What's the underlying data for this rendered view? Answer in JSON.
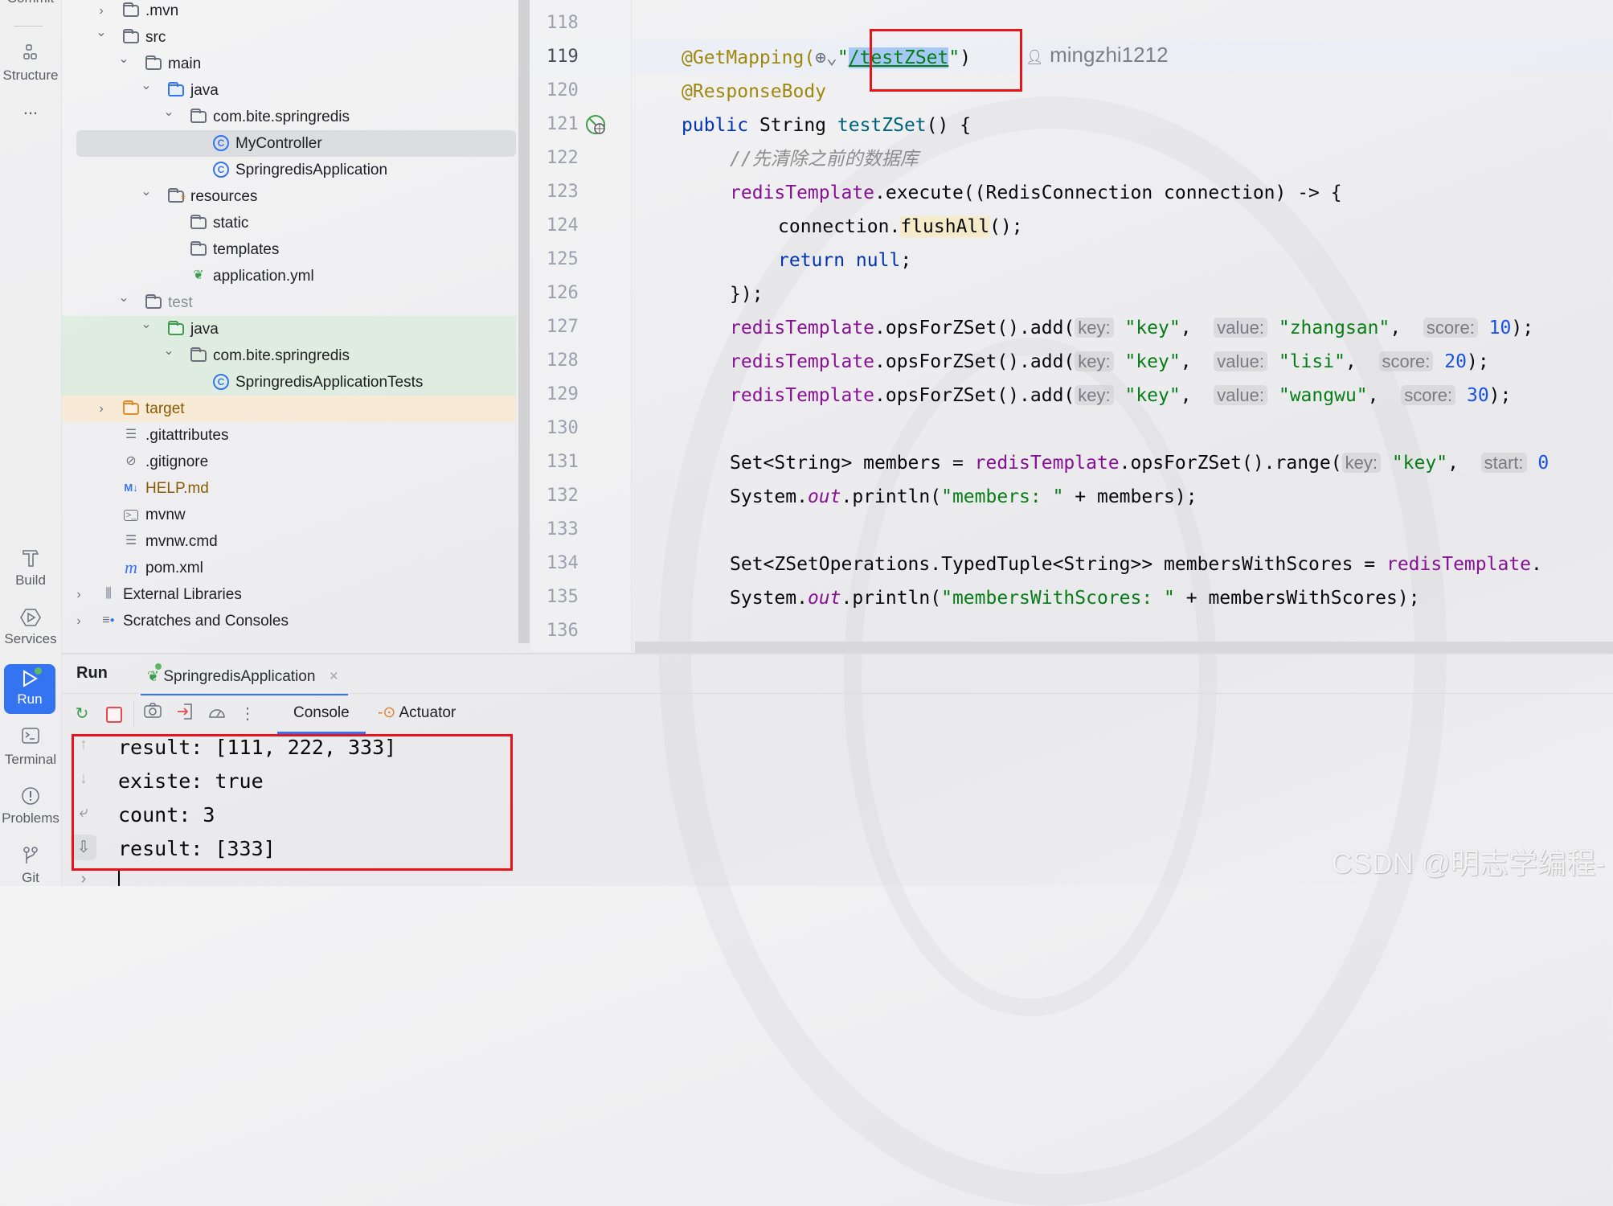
{
  "toolstrip": {
    "items": [
      {
        "label": "Commit",
        "icon": "commit-icon"
      },
      {
        "label": "Structure",
        "icon": "structure-icon"
      },
      {
        "label": "...",
        "icon": "more-icon"
      },
      {
        "label": "Build",
        "icon": "hammer-icon"
      },
      {
        "label": "Services",
        "icon": "services-icon"
      },
      {
        "label": "Run",
        "icon": "run-icon",
        "active": true
      },
      {
        "label": "Terminal",
        "icon": "terminal-icon"
      },
      {
        "label": "Problems",
        "icon": "problems-icon"
      },
      {
        "label": "Git",
        "icon": "git-icon"
      }
    ]
  },
  "project": {
    "tree": [
      {
        "name": ".mvn",
        "type": "folder",
        "expanded": false
      },
      {
        "name": "src",
        "type": "folder",
        "expanded": true
      },
      {
        "name": "main",
        "type": "folder",
        "expanded": true
      },
      {
        "name": "java",
        "type": "source-folder",
        "expanded": true
      },
      {
        "name": "com.bite.springredis",
        "type": "package",
        "expanded": true
      },
      {
        "name": "MyController",
        "type": "class",
        "selected": true
      },
      {
        "name": "SpringredisApplication",
        "type": "spring-boot-class"
      },
      {
        "name": "resources",
        "type": "resources-folder",
        "expanded": true
      },
      {
        "name": "static",
        "type": "folder"
      },
      {
        "name": "templates",
        "type": "folder"
      },
      {
        "name": "application.yml",
        "type": "spring-config"
      },
      {
        "name": "test",
        "type": "folder",
        "expanded": true
      },
      {
        "name": "java",
        "type": "test-source-folder",
        "expanded": true
      },
      {
        "name": "com.bite.springredis",
        "type": "package",
        "expanded": true
      },
      {
        "name": "SpringredisApplicationTests",
        "type": "test-class"
      },
      {
        "name": "target",
        "type": "excluded-folder",
        "expanded": false
      },
      {
        "name": ".gitattributes",
        "type": "text"
      },
      {
        "name": ".gitignore",
        "type": "ignore"
      },
      {
        "name": "HELP.md",
        "type": "markdown"
      },
      {
        "name": "mvnw",
        "type": "shell"
      },
      {
        "name": "mvnw.cmd",
        "type": "text"
      },
      {
        "name": "pom.xml",
        "type": "maven"
      },
      {
        "name": "External Libraries",
        "type": "libraries",
        "expanded": false
      },
      {
        "name": "Scratches and Consoles",
        "type": "scratches",
        "expanded": false
      }
    ]
  },
  "editor": {
    "line_numbers": [
      "118",
      "119",
      "120",
      "121",
      "122",
      "123",
      "124",
      "125",
      "126",
      "127",
      "128",
      "129",
      "130",
      "131",
      "132",
      "133",
      "134",
      "135",
      "136"
    ],
    "author_hint": "mingzhi1212",
    "code": {
      "l119_ann": "@GetMapping(",
      "l119_q1": "\"",
      "l119_path": "/testZSet",
      "l119_q2": "\"",
      "l119_close": ")",
      "l120": "@ResponseBody",
      "l121_kw": "public",
      "l121_type": " String ",
      "l121_fn": "testZSet",
      "l121_rest": "() {",
      "l122": "//先清除之前的数据库",
      "l123_fld": "redisTemplate",
      "l123_rest": ".execute((RedisConnection connection) -> {",
      "l124_a": "connection.",
      "l124_hl": "flushAll",
      "l124_b": "();",
      "l125_kw": "return null",
      "l125_b": ";",
      "l126": "});",
      "add_lines": [
        {
          "fld": "redisTemplate",
          "call": ".opsForZSet().add(",
          "key_hint": "key:",
          "key": "\"key\"",
          "value_hint": "value:",
          "value": "\"zhangsan\"",
          "score_hint": "score:",
          "score": "10"
        },
        {
          "fld": "redisTemplate",
          "call": ".opsForZSet().add(",
          "key_hint": "key:",
          "key": "\"key\"",
          "value_hint": "value:",
          "value": "\"lisi\"",
          "score_hint": "score:",
          "score": "20"
        },
        {
          "fld": "redisTemplate",
          "call": ".opsForZSet().add(",
          "key_hint": "key:",
          "key": "\"key\"",
          "value_hint": "value:",
          "value": "\"wangwu\"",
          "score_hint": "score:",
          "score": "30"
        }
      ],
      "l131_a": "Set<String> members = ",
      "l131_fld": "redisTemplate",
      "l131_b": ".opsForZSet().range(",
      "l131_key_hint": "key:",
      "l131_key": "\"key\"",
      "l131_start_hint": "start:",
      "l131_start": "0",
      "l132_a": "System.",
      "l132_out": "out",
      "l132_b": ".println(",
      "l132_str": "\"members: \"",
      "l132_c": " + members);",
      "l134_a": "Set<ZSetOperations.TypedTuple<String>> membersWithScores = ",
      "l134_fld": "redisTemplate",
      "l134_b": ".",
      "l135_a": "System.",
      "l135_out": "out",
      "l135_b": ".println(",
      "l135_str": "\"membersWithScores: \"",
      "l135_c": " + membersWithScores);"
    }
  },
  "run_panel": {
    "title": "Run",
    "tab_label": "SpringredisApplication",
    "subtabs": {
      "console": "Console",
      "actuator": "Actuator"
    },
    "output": [
      "result: [111, 222, 333]",
      "existe: true",
      "count: 3",
      "result: [333]"
    ]
  },
  "watermark": "CSDN @明志学编程-",
  "colors": {
    "accent": "#3574f0",
    "highlight_box": "#e8141c"
  }
}
